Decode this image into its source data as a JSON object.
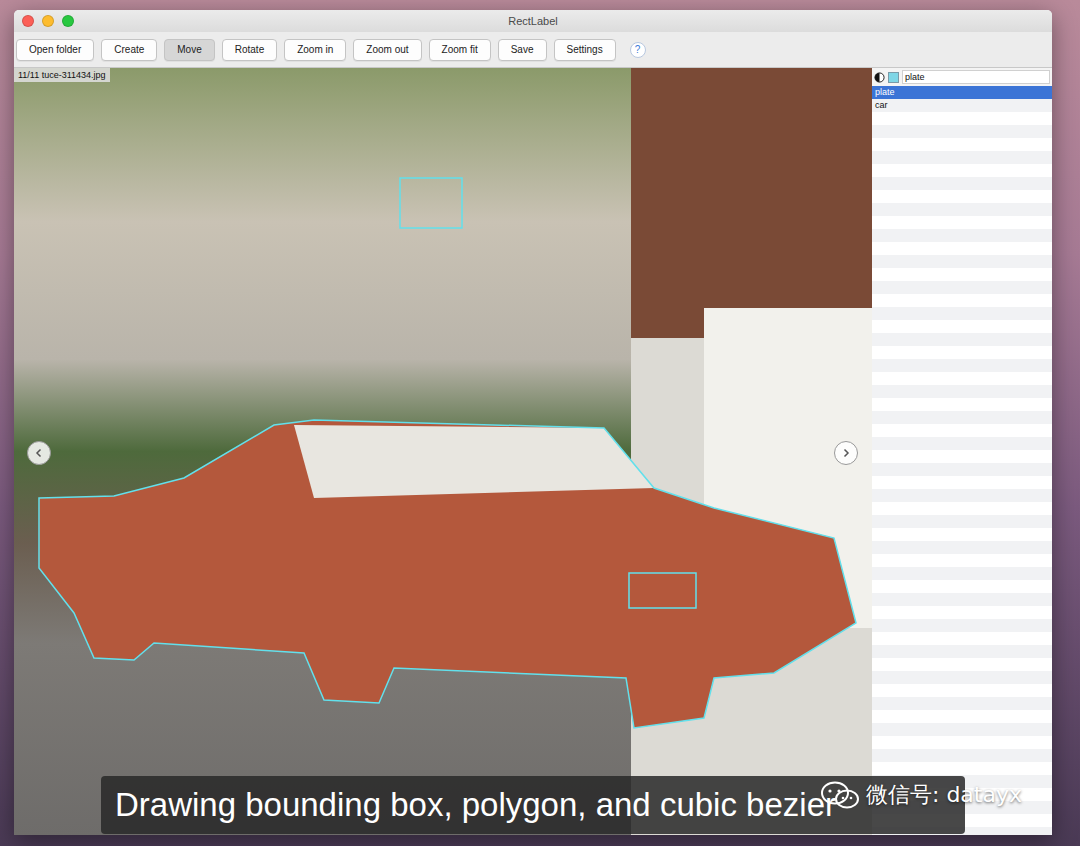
{
  "window": {
    "title": "RectLabel"
  },
  "toolbar": [
    {
      "label": "Open folder",
      "selected": false
    },
    {
      "label": "Create",
      "selected": false
    },
    {
      "label": "Move",
      "selected": true
    },
    {
      "label": "Rotate",
      "selected": false
    },
    {
      "label": "Zoom in",
      "selected": false
    },
    {
      "label": "Zoom out",
      "selected": false
    },
    {
      "label": "Zoom fit",
      "selected": false
    },
    {
      "label": "Save",
      "selected": false
    },
    {
      "label": "Settings",
      "selected": false
    }
  ],
  "help_button": "?",
  "image": {
    "caption": "11/11 tuce-311434.jpg"
  },
  "label_panel": {
    "field": "plate",
    "items": [
      {
        "label": "plate",
        "selected": true
      },
      {
        "label": "car",
        "selected": false
      }
    ]
  },
  "subtitle": "Drawing bounding box, polygon, and cubic bezier",
  "watermark": "微信号: datayx"
}
